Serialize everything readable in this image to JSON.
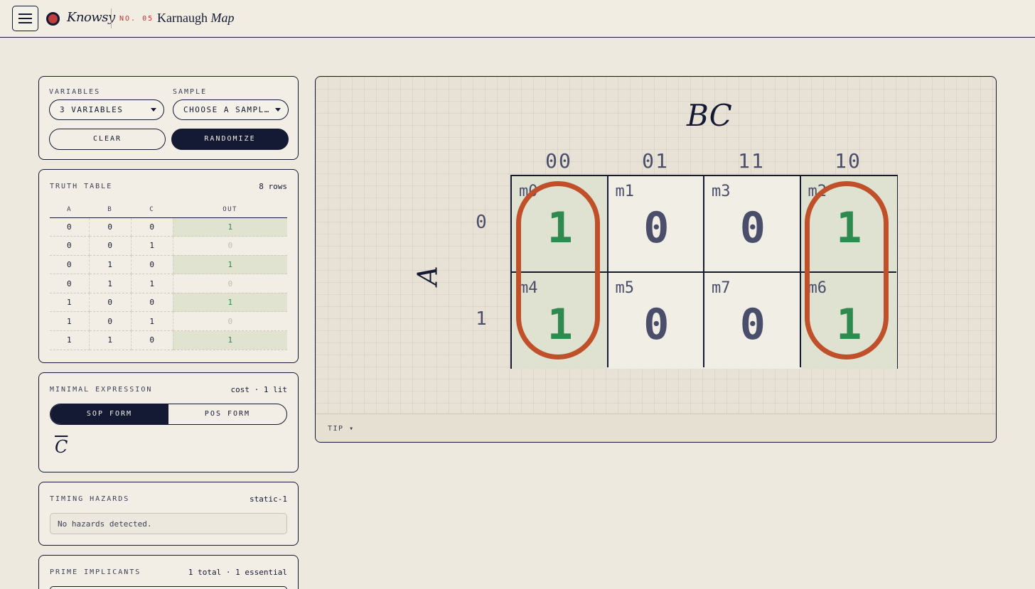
{
  "header": {
    "brand": "Knowsy",
    "issue": "NO. 05",
    "title_plain": "Karnaugh",
    "title_italic": "Map"
  },
  "controls": {
    "variables_label": "VARIABLES",
    "variables_value": "3 VARIABLES",
    "sample_label": "SAMPLE",
    "sample_value": "CHOOSE A SAMPL…",
    "clear_label": "CLEAR",
    "randomize_label": "RANDOMIZE"
  },
  "truth_table": {
    "title": "TRUTH TABLE",
    "count": "8 rows",
    "headers": [
      "A",
      "B",
      "C",
      "OUT"
    ],
    "rows": [
      [
        "0",
        "0",
        "0",
        "1"
      ],
      [
        "0",
        "0",
        "1",
        "0"
      ],
      [
        "0",
        "1",
        "0",
        "1"
      ],
      [
        "0",
        "1",
        "1",
        "0"
      ],
      [
        "1",
        "0",
        "0",
        "1"
      ],
      [
        "1",
        "0",
        "1",
        "0"
      ],
      [
        "1",
        "1",
        "0",
        "1"
      ]
    ]
  },
  "minimal": {
    "title": "MINIMAL EXPRESSION",
    "cost": "cost · 1 lit",
    "sop_label": "SOP FORM",
    "pos_label": "POS FORM",
    "expression": "C"
  },
  "hazards": {
    "title": "TIMING HAZARDS",
    "type": "static-1",
    "message": "No hazards detected."
  },
  "prime": {
    "title": "PRIME IMPLICANTS",
    "summary": "1 total · 1 essential"
  },
  "kmap": {
    "col_var": "BC",
    "row_var": "A",
    "col_labels": [
      "00",
      "01",
      "11",
      "10"
    ],
    "row_labels": [
      "0",
      "1"
    ],
    "cells": [
      [
        {
          "m": "m0",
          "v": "1"
        },
        {
          "m": "m1",
          "v": "0"
        },
        {
          "m": "m3",
          "v": "0"
        },
        {
          "m": "m2",
          "v": "1"
        }
      ],
      [
        {
          "m": "m4",
          "v": "1"
        },
        {
          "m": "m5",
          "v": "0"
        },
        {
          "m": "m7",
          "v": "0"
        },
        {
          "m": "m6",
          "v": "1"
        }
      ]
    ],
    "group_color": "#c0502a",
    "one_color": "#2f8a4f",
    "tip_label": "TIP ▾"
  }
}
